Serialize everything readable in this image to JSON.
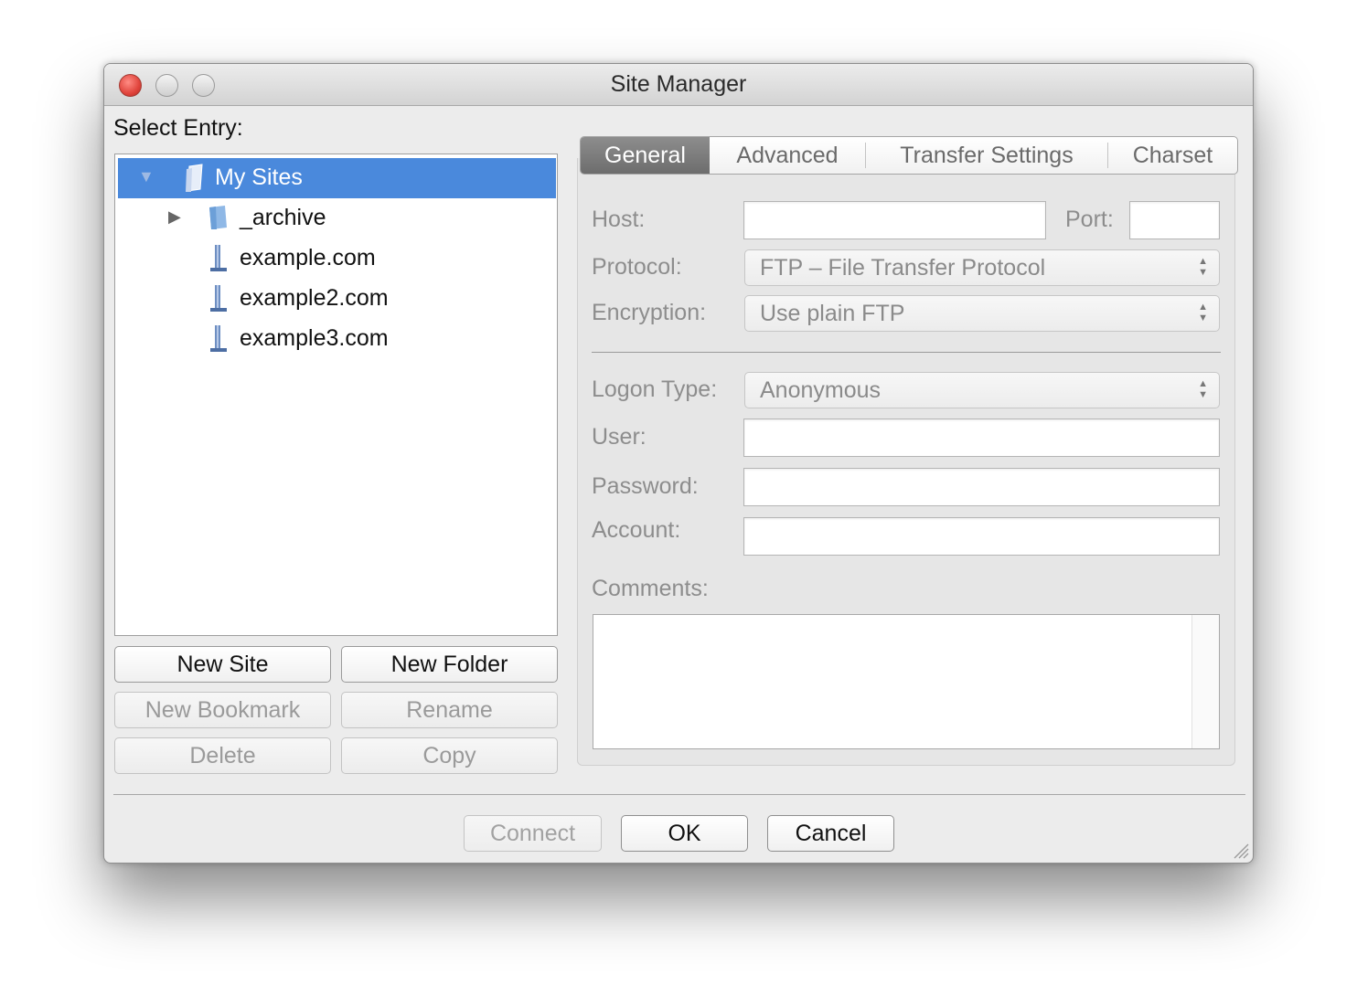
{
  "window": {
    "title": "Site Manager"
  },
  "tree": {
    "label": "Select Entry:",
    "items": [
      {
        "label": "My Sites",
        "icon": "sites-root-icon",
        "expanded": true,
        "selected": true
      },
      {
        "label": "_archive",
        "icon": "folder-icon",
        "expanded": false
      },
      {
        "label": "example.com",
        "icon": "server-icon"
      },
      {
        "label": "example2.com",
        "icon": "server-icon"
      },
      {
        "label": "example3.com",
        "icon": "server-icon"
      }
    ]
  },
  "site_buttons": {
    "new_site": "New Site",
    "new_folder": "New Folder",
    "new_bookmark": "New Bookmark",
    "rename": "Rename",
    "delete": "Delete",
    "copy": "Copy"
  },
  "tabs": [
    "General",
    "Advanced",
    "Transfer Settings",
    "Charset"
  ],
  "active_tab": "General",
  "general": {
    "host_label": "Host:",
    "host_value": "",
    "port_label": "Port:",
    "port_value": "",
    "protocol_label": "Protocol:",
    "protocol_value": "FTP – File Transfer Protocol",
    "encryption_label": "Encryption:",
    "encryption_value": "Use plain FTP",
    "logon_type_label": "Logon Type:",
    "logon_type_value": "Anonymous",
    "user_label": "User:",
    "user_value": "",
    "password_label": "Password:",
    "password_value": "",
    "account_label": "Account:",
    "account_value": "",
    "comments_label": "Comments:",
    "comments_value": ""
  },
  "footer": {
    "connect": "Connect",
    "ok": "OK",
    "cancel": "Cancel"
  },
  "colors": {
    "selection": "#4a89dc",
    "close_button": "#e0443c",
    "active_tab": "#7d7d7d"
  }
}
